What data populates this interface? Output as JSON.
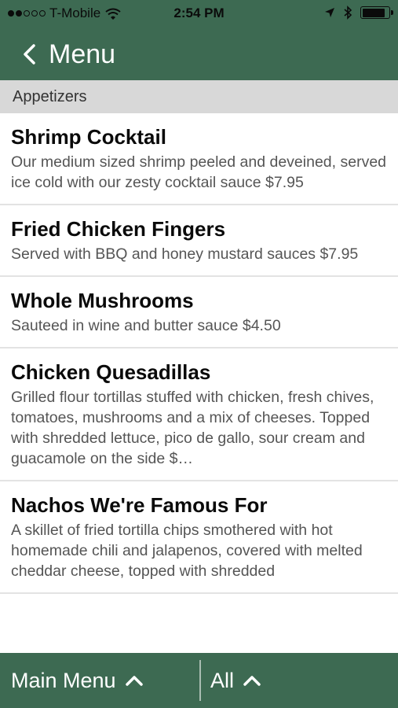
{
  "status_bar": {
    "carrier": "T-Mobile",
    "signal_filled": 2,
    "signal_total": 5,
    "time": "2:54 PM",
    "battery_level": 0.85
  },
  "nav": {
    "back_label": "Menu"
  },
  "section": {
    "title": "Appetizers"
  },
  "items": [
    {
      "title": "Shrimp Cocktail",
      "description": "Our medium sized shrimp peeled and deveined, served ice cold with our zesty cocktail sauce $7.95"
    },
    {
      "title": "Fried Chicken Fingers",
      "description": "Served with BBQ and honey mustard sauces $7.95"
    },
    {
      "title": "Whole Mushrooms",
      "description": "Sauteed in wine and butter sauce $4.50"
    },
    {
      "title": "Chicken Quesadillas",
      "description": "Grilled flour tortillas stuffed with chicken, fresh chives, tomatoes, mushrooms and a mix of cheeses. Topped with shredded lettuce, pico de gallo, sour cream and guacamole on the side $…"
    },
    {
      "title": "Nachos We're Famous For",
      "description": "A skillet of fried tortilla chips smothered with hot homemade chili and jalapenos, covered with melted cheddar cheese, topped with shredded"
    }
  ],
  "tab_bar": {
    "main_menu_label": "Main Menu",
    "filter_label": "All"
  },
  "colors": {
    "brand_green": "#3d6a52",
    "section_gray": "#d8d8d8"
  },
  "icons": {
    "back": "chevron-left-icon",
    "tab_caret": "chevron-up-icon",
    "wifi": "wifi-icon",
    "location": "location-arrow-icon",
    "bluetooth": "bluetooth-icon",
    "battery": "battery-icon"
  }
}
